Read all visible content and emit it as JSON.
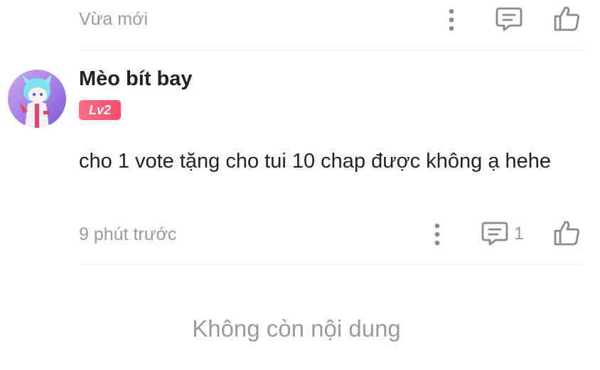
{
  "previous_comment": {
    "timestamp": "Vừa mới",
    "icons": {
      "more": "more-vertical-icon",
      "reply": "comment-icon",
      "like": "thumbs-up-icon"
    }
  },
  "comment": {
    "avatar": "user-avatar",
    "username": "Mèo bít bay",
    "level": "Lv2",
    "text": "cho 1 vote tặng cho tui 10 chap được không ạ hehe",
    "timestamp": "9 phút trước",
    "reply_count": "1"
  },
  "footer": {
    "empty_message": "Không còn nội dung"
  },
  "colors": {
    "muted_text": "#9a9a9a",
    "main_text": "#222222",
    "badge": "#fb4a6a",
    "divider": "#ececec"
  }
}
